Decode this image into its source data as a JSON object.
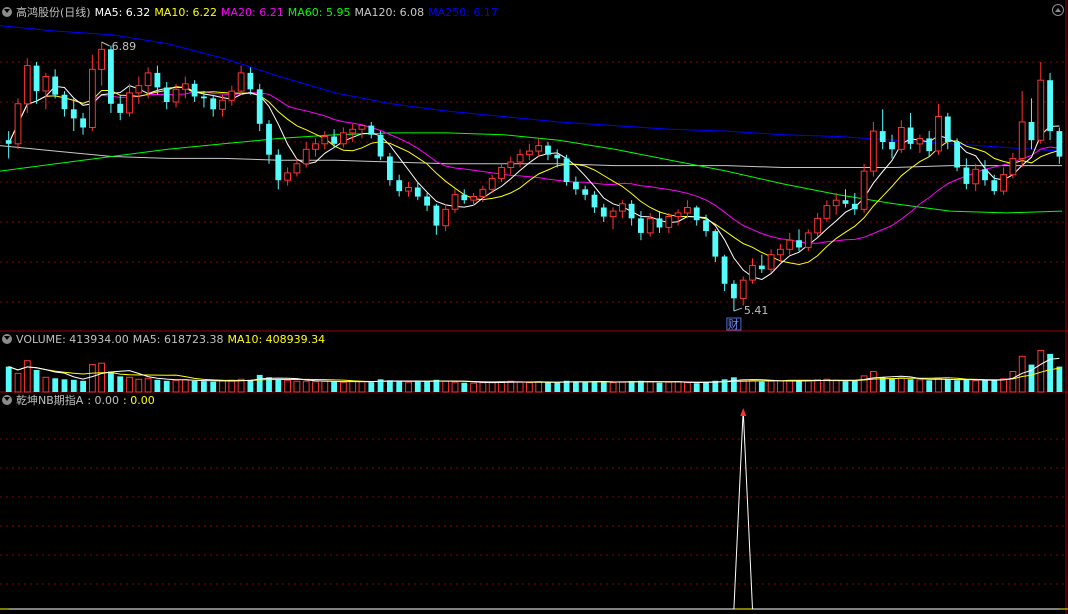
{
  "colors": {
    "bg": "#000000",
    "up": "#ff3232",
    "down": "#54fcfc",
    "grid": "#8b0000",
    "panel_border": "#a00000",
    "ma5": "#ffffff",
    "ma10": "#ffff00",
    "ma20": "#ff00ff",
    "ma60": "#00ff00",
    "ma120": "#c8c8c8",
    "ma250": "#0000ff",
    "vol_ma5": "#ffffff",
    "vol_ma10": "#ffff00",
    "indicator_line": "#ffffff",
    "indicator_base": "#ffff00",
    "signal_arrow": "#ff3232"
  },
  "main_panel": {
    "title": "高鸿股份(日线)",
    "ma_labels": [
      {
        "text": "MA5: 6.32",
        "color": "#ffffff"
      },
      {
        "text": "MA10: 6.22",
        "color": "#ffff00"
      },
      {
        "text": "MA20: 6.21",
        "color": "#ff00ff"
      },
      {
        "text": "MA60: 5.95",
        "color": "#00ff00"
      },
      {
        "text": "MA120: 6.08",
        "color": "#c8c8c8"
      },
      {
        "text": "MA250: 6.17",
        "color": "#0000ff"
      }
    ],
    "high_label": "6.89",
    "low_label": "5.41",
    "finance_marker": "财"
  },
  "volume_panel": {
    "labels": [
      {
        "text": "VOLUME: 413934.00",
        "color": "#c0c0c0"
      },
      {
        "text": "MA5: 618723.38",
        "color": "#c0c0c0"
      },
      {
        "text": "MA10: 408939.34",
        "color": "#ffff00"
      }
    ]
  },
  "indicator_panel": {
    "labels": [
      {
        "text": "乾坤NB期指A",
        "color": "#c0c0c0"
      },
      {
        "text": ": 0.00",
        "color": "#c0c0c0"
      },
      {
        "text": ": 0.00",
        "color": "#ffff00"
      }
    ]
  },
  "chart_data": {
    "type": "candlestick",
    "price_range": [
      5.35,
      7.0
    ],
    "ohlc": [
      [
        6.35,
        6.4,
        6.25,
        6.33
      ],
      [
        6.33,
        6.58,
        6.3,
        6.55
      ],
      [
        6.55,
        6.8,
        6.5,
        6.76
      ],
      [
        6.76,
        6.78,
        6.55,
        6.62
      ],
      [
        6.62,
        6.72,
        6.52,
        6.7
      ],
      [
        6.7,
        6.74,
        6.58,
        6.6
      ],
      [
        6.6,
        6.62,
        6.48,
        6.52
      ],
      [
        6.52,
        6.58,
        6.4,
        6.47
      ],
      [
        6.47,
        6.5,
        6.38,
        6.42
      ],
      [
        6.42,
        6.82,
        6.4,
        6.74
      ],
      [
        6.74,
        6.89,
        6.65,
        6.85
      ],
      [
        6.85,
        6.87,
        6.5,
        6.55
      ],
      [
        6.55,
        6.6,
        6.46,
        6.5
      ],
      [
        6.5,
        6.66,
        6.48,
        6.61
      ],
      [
        6.61,
        6.7,
        6.55,
        6.65
      ],
      [
        6.65,
        6.75,
        6.58,
        6.72
      ],
      [
        6.72,
        6.76,
        6.6,
        6.64
      ],
      [
        6.64,
        6.67,
        6.52,
        6.56
      ],
      [
        6.56,
        6.66,
        6.53,
        6.63
      ],
      [
        6.63,
        6.7,
        6.58,
        6.66
      ],
      [
        6.66,
        6.68,
        6.56,
        6.59
      ],
      [
        6.59,
        6.62,
        6.53,
        6.58
      ],
      [
        6.58,
        6.6,
        6.48,
        6.52
      ],
      [
        6.52,
        6.6,
        6.48,
        6.57
      ],
      [
        6.57,
        6.65,
        6.54,
        6.62
      ],
      [
        6.62,
        6.76,
        6.6,
        6.72
      ],
      [
        6.72,
        6.75,
        6.6,
        6.63
      ],
      [
        6.63,
        6.66,
        6.4,
        6.44
      ],
      [
        6.44,
        6.46,
        6.22,
        6.27
      ],
      [
        6.27,
        6.3,
        6.08,
        6.13
      ],
      [
        6.13,
        6.2,
        6.1,
        6.17
      ],
      [
        6.17,
        6.25,
        6.15,
        6.22
      ],
      [
        6.22,
        6.34,
        6.2,
        6.3
      ],
      [
        6.3,
        6.36,
        6.26,
        6.33
      ],
      [
        6.33,
        6.4,
        6.3,
        6.37
      ],
      [
        6.37,
        6.41,
        6.31,
        6.33
      ],
      [
        6.33,
        6.42,
        6.31,
        6.39
      ],
      [
        6.39,
        6.44,
        6.34,
        6.41
      ],
      [
        6.41,
        6.44,
        6.36,
        6.43
      ],
      [
        6.43,
        6.45,
        6.36,
        6.38
      ],
      [
        6.38,
        6.4,
        6.24,
        6.26
      ],
      [
        6.26,
        6.28,
        6.1,
        6.13
      ],
      [
        6.13,
        6.16,
        6.04,
        6.07
      ],
      [
        6.07,
        6.12,
        6.04,
        6.09
      ],
      [
        6.09,
        6.12,
        6.02,
        6.04
      ],
      [
        6.04,
        6.06,
        5.96,
        5.99
      ],
      [
        5.99,
        6.0,
        5.83,
        5.88
      ],
      [
        5.88,
        6.0,
        5.85,
        5.97
      ],
      [
        5.97,
        6.08,
        5.95,
        6.05
      ],
      [
        6.05,
        6.08,
        6.0,
        6.02
      ],
      [
        6.02,
        6.06,
        5.99,
        6.04
      ],
      [
        6.04,
        6.1,
        6.01,
        6.08
      ],
      [
        6.08,
        6.16,
        6.06,
        6.14
      ],
      [
        6.14,
        6.22,
        6.12,
        6.2
      ],
      [
        6.2,
        6.26,
        6.16,
        6.23
      ],
      [
        6.23,
        6.3,
        6.2,
        6.27
      ],
      [
        6.27,
        6.33,
        6.24,
        6.29
      ],
      [
        6.29,
        6.36,
        6.26,
        6.32
      ],
      [
        6.32,
        6.34,
        6.24,
        6.27
      ],
      [
        6.27,
        6.3,
        6.2,
        6.25
      ],
      [
        6.25,
        6.27,
        6.1,
        6.12
      ],
      [
        6.12,
        6.15,
        6.05,
        6.08
      ],
      [
        6.08,
        6.1,
        6.02,
        6.05
      ],
      [
        6.05,
        6.07,
        5.95,
        5.98
      ],
      [
        5.98,
        6.0,
        5.9,
        5.93
      ],
      [
        5.93,
        5.98,
        5.86,
        5.96
      ],
      [
        5.96,
        6.02,
        5.92,
        6.0
      ],
      [
        6.0,
        6.02,
        5.88,
        5.92
      ],
      [
        5.92,
        5.96,
        5.8,
        5.84
      ],
      [
        5.84,
        5.95,
        5.82,
        5.92
      ],
      [
        5.92,
        5.96,
        5.84,
        5.87
      ],
      [
        5.87,
        5.95,
        5.84,
        5.93
      ],
      [
        5.93,
        5.97,
        5.88,
        5.95
      ],
      [
        5.95,
        6.02,
        5.92,
        5.98
      ],
      [
        5.98,
        5.99,
        5.88,
        5.91
      ],
      [
        5.91,
        5.94,
        5.82,
        5.85
      ],
      [
        5.85,
        5.86,
        5.68,
        5.71
      ],
      [
        5.71,
        5.72,
        5.52,
        5.56
      ],
      [
        5.56,
        5.58,
        5.41,
        5.48
      ],
      [
        5.48,
        5.6,
        5.44,
        5.58
      ],
      [
        5.58,
        5.7,
        5.56,
        5.66
      ],
      [
        5.66,
        5.72,
        5.62,
        5.64
      ],
      [
        5.64,
        5.75,
        5.62,
        5.72
      ],
      [
        5.72,
        5.78,
        5.68,
        5.75
      ],
      [
        5.75,
        5.84,
        5.72,
        5.8
      ],
      [
        5.8,
        5.86,
        5.74,
        5.76
      ],
      [
        5.76,
        5.86,
        5.74,
        5.84
      ],
      [
        5.84,
        5.95,
        5.82,
        5.92
      ],
      [
        5.92,
        6.02,
        5.9,
        5.99
      ],
      [
        5.99,
        6.06,
        5.94,
        6.02
      ],
      [
        6.02,
        6.08,
        5.98,
        6.0
      ],
      [
        6.0,
        6.06,
        5.94,
        5.97
      ],
      [
        5.97,
        6.22,
        5.95,
        6.18
      ],
      [
        6.18,
        6.45,
        6.15,
        6.4
      ],
      [
        6.4,
        6.52,
        6.3,
        6.34
      ],
      [
        6.34,
        6.38,
        6.25,
        6.3
      ],
      [
        6.3,
        6.46,
        6.28,
        6.42
      ],
      [
        6.42,
        6.5,
        6.3,
        6.33
      ],
      [
        6.33,
        6.38,
        6.28,
        6.36
      ],
      [
        6.36,
        6.4,
        6.26,
        6.29
      ],
      [
        6.29,
        6.55,
        6.27,
        6.48
      ],
      [
        6.48,
        6.5,
        6.3,
        6.34
      ],
      [
        6.34,
        6.36,
        6.18,
        6.2
      ],
      [
        6.2,
        6.25,
        6.08,
        6.11
      ],
      [
        6.11,
        6.22,
        6.07,
        6.19
      ],
      [
        6.19,
        6.24,
        6.1,
        6.13
      ],
      [
        6.13,
        6.16,
        6.05,
        6.07
      ],
      [
        6.07,
        6.2,
        6.05,
        6.16
      ],
      [
        6.16,
        6.28,
        6.14,
        6.25
      ],
      [
        6.25,
        6.62,
        6.2,
        6.45
      ],
      [
        6.45,
        6.58,
        6.3,
        6.35
      ],
      [
        6.35,
        6.78,
        6.33,
        6.68
      ],
      [
        6.68,
        6.72,
        6.35,
        6.4
      ],
      [
        6.4,
        6.42,
        6.22,
        6.26
      ]
    ],
    "ma": {
      "ma5": {
        "n": 5,
        "start": 0
      },
      "ma10": {
        "n": 10,
        "start": 9
      },
      "ma20": {
        "n": 20,
        "start": 19
      },
      "ma60": {
        "points": [
          6.18,
          6.22,
          6.26,
          6.3,
          6.33,
          6.36,
          6.38,
          6.39,
          6.39,
          6.38,
          6.35,
          6.3,
          6.24,
          6.18,
          6.11,
          6.05,
          6.0,
          5.96,
          5.95,
          5.96
        ]
      },
      "ma120": {
        "points": [
          6.32,
          6.29,
          6.26,
          6.25,
          6.25,
          6.24,
          6.24,
          6.23,
          6.22,
          6.22,
          6.22,
          6.21,
          6.21,
          6.21,
          6.2,
          6.2,
          6.2,
          6.21,
          6.21,
          6.21
        ]
      },
      "ma250": {
        "points": [
          6.98,
          6.95,
          6.93,
          6.88,
          6.8,
          6.7,
          6.61,
          6.55,
          6.51,
          6.48,
          6.45,
          6.43,
          6.41,
          6.4,
          6.38,
          6.37,
          6.35,
          6.33,
          6.31,
          6.29
        ]
      }
    },
    "volume": [
      520,
      380,
      640,
      450,
      300,
      280,
      260,
      250,
      230,
      560,
      590,
      420,
      320,
      300,
      260,
      280,
      250,
      230,
      240,
      250,
      230,
      220,
      210,
      230,
      240,
      260,
      250,
      350,
      300,
      260,
      240,
      220,
      220,
      210,
      220,
      210,
      200,
      220,
      210,
      200,
      260,
      240,
      220,
      200,
      210,
      230,
      250,
      220,
      200,
      190,
      180,
      190,
      200,
      210,
      220,
      200,
      190,
      210,
      200,
      190,
      230,
      210,
      200,
      220,
      210,
      190,
      200,
      220,
      230,
      210,
      190,
      200,
      210,
      190,
      180,
      200,
      230,
      260,
      300,
      250,
      230,
      210,
      220,
      230,
      240,
      220,
      230,
      250,
      260,
      240,
      220,
      230,
      330,
      420,
      300,
      270,
      290,
      260,
      250,
      240,
      280,
      260,
      240,
      250,
      230,
      240,
      250,
      270,
      420,
      730,
      560,
      850,
      780,
      520
    ],
    "volume_range": [
      0,
      900
    ],
    "volume_ma_levels": {
      "ma5": 619,
      "ma10": 409
    },
    "indicator": {
      "values_by_index": {
        "79": 1.0
      },
      "range": [
        0,
        1.0
      ],
      "signal_index": 79
    }
  }
}
